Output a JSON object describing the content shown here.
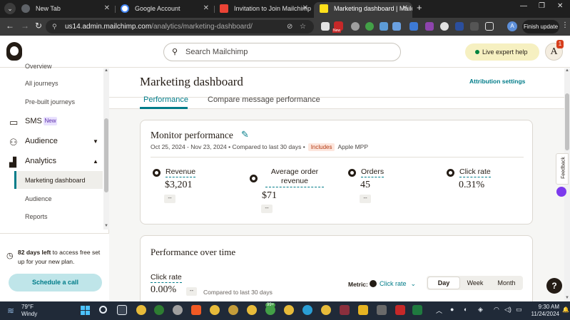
{
  "browser": {
    "tabs": [
      {
        "title": "New Tab",
        "active": false
      },
      {
        "title": "Google Account",
        "active": false
      },
      {
        "title": "Invitation to Join Mailchimp Ac",
        "active": false
      },
      {
        "title": "Marketing dashboard | Mailchim",
        "active": true
      }
    ],
    "url_host": "us14.admin.mailchimp.com",
    "url_path": "/analytics/marketing-dashboard/",
    "profile_initial": "A",
    "finish_update_label": "Finish update",
    "ext_badge": "New"
  },
  "header": {
    "search_placeholder": "Search Mailchimp",
    "live_help_label": "Live expert help",
    "avatar_initial": "A",
    "avatar_badge": "1"
  },
  "sidebar": {
    "items": [
      {
        "label": "Overview",
        "level": "sub"
      },
      {
        "label": "All journeys",
        "level": "sub"
      },
      {
        "label": "Pre-built journeys",
        "level": "sub"
      },
      {
        "label": "SMS",
        "level": "main",
        "badge": "New",
        "icon": "sms-icon"
      },
      {
        "label": "Audience",
        "level": "main",
        "icon": "audience-icon",
        "expanded": false
      },
      {
        "label": "Analytics",
        "level": "main",
        "icon": "analytics-icon",
        "expanded": true
      },
      {
        "label": "Marketing dashboard",
        "level": "sub",
        "active": true
      },
      {
        "label": "Audience",
        "level": "sub"
      },
      {
        "label": "Reports",
        "level": "sub"
      }
    ],
    "trial": {
      "days_bold": "82 days left",
      "text": " to access free set up for your new plan.",
      "button": "Schedule a call"
    }
  },
  "main": {
    "title": "Marketing dashboard",
    "attribution_link": "Attribution settings",
    "tabs": [
      {
        "label": "Performance",
        "active": true
      },
      {
        "label": "Compare message performance",
        "active": false
      }
    ],
    "monitor": {
      "title": "Monitor performance",
      "date_range": "Oct 25, 2024 - Nov 23, 2024 • Compared to last 30 days •",
      "includes_badge": "Includes",
      "includes_text": "Apple MPP",
      "metrics": [
        {
          "label": "Revenue",
          "value": "$3,201",
          "change": "--"
        },
        {
          "label": "Average order revenue",
          "value": "$71",
          "change": "--"
        },
        {
          "label": "Orders",
          "value": "45",
          "change": "--"
        },
        {
          "label": "Click rate",
          "value": "0.31%",
          "change": "--"
        }
      ]
    },
    "performance_over_time": {
      "title": "Performance over time",
      "metric_label": "Click rate",
      "metric_value": "0.00%",
      "change": "--",
      "compared_text": "Compared to last 30 days",
      "metric_select_label": "Metric:",
      "metric_select_value": "Click rate",
      "periods": [
        {
          "label": "Day",
          "active": true
        },
        {
          "label": "Week",
          "active": false
        },
        {
          "label": "Month",
          "active": false
        }
      ]
    },
    "feedback_label": "Feedback",
    "help_label": "?"
  },
  "taskbar": {
    "weather_temp": "79°F",
    "weather_desc": "Windy",
    "time": "9:30 AM",
    "date": "11/24/2024",
    "badge_count": "99+"
  },
  "colors": {
    "accent": "#007c89",
    "brand_dark": "#241c15",
    "includes_badge_bg": "#fde6dd",
    "new_badge_bg": "#e9e1ff",
    "live_help_bg": "#f6f0c1"
  }
}
